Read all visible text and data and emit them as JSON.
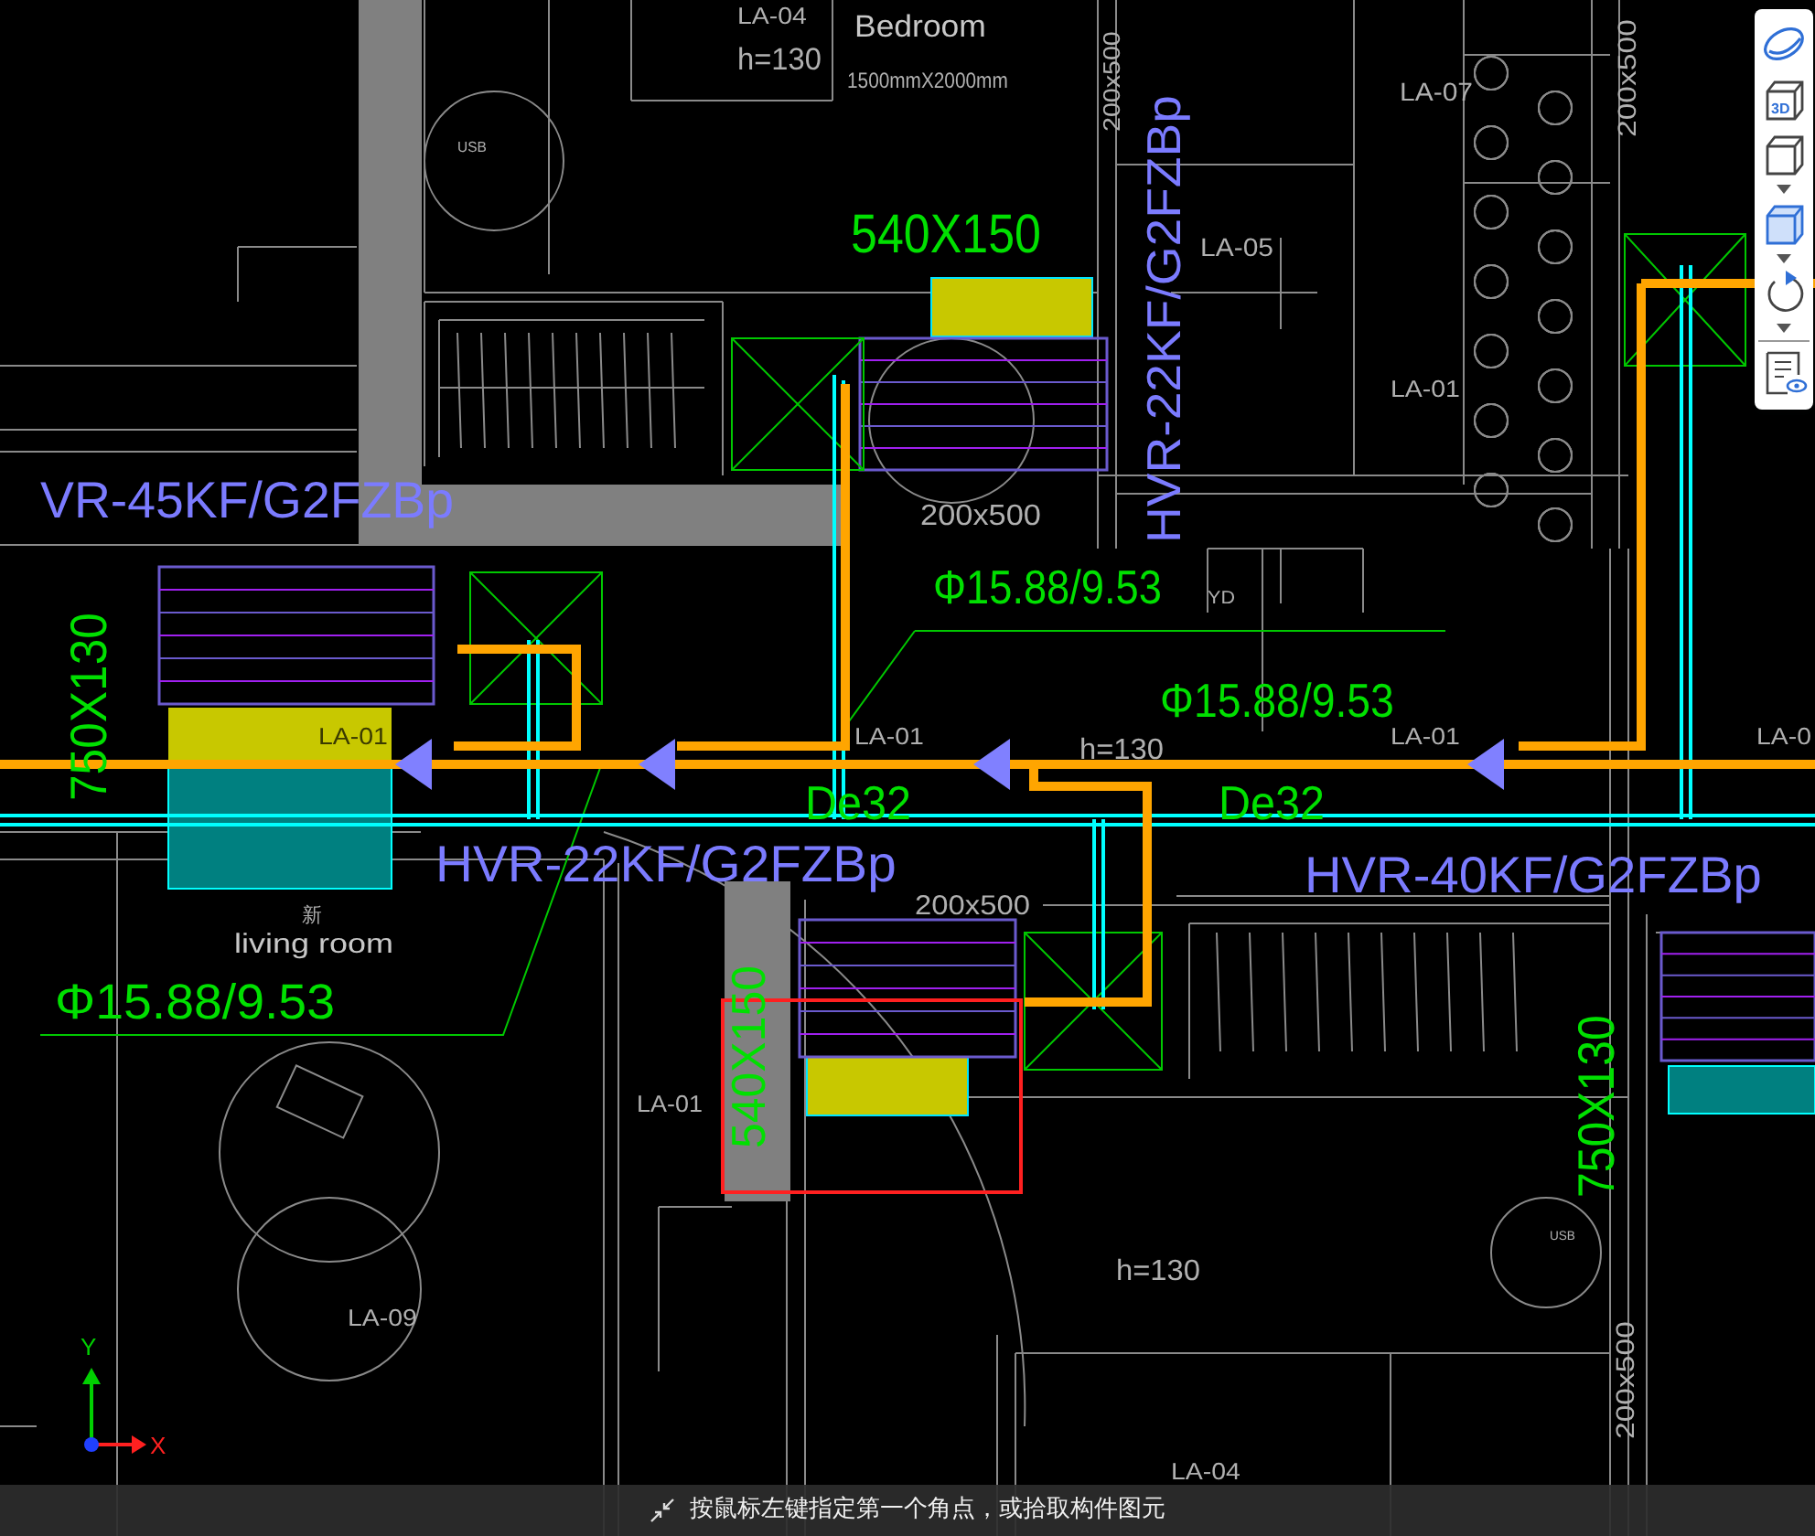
{
  "drawing_labels": [
    {
      "text": "LA-04",
      "kind": "tag"
    },
    {
      "text": "h=130",
      "kind": "elevation"
    },
    {
      "text": "Bedroom",
      "kind": "room"
    },
    {
      "text": "1500mmX2000mm",
      "kind": "note"
    },
    {
      "text": "USB",
      "kind": "note"
    },
    {
      "text": "540X150",
      "kind": "size"
    },
    {
      "text": "200x500",
      "kind": "tag"
    },
    {
      "text": "HVR-22KF/G2FZBp",
      "kind": "model"
    },
    {
      "text": "LA-07",
      "kind": "tag"
    },
    {
      "text": "LA-05",
      "kind": "tag"
    },
    {
      "text": "LA-01",
      "kind": "tag"
    },
    {
      "text": "200x500",
      "kind": "tag"
    },
    {
      "text": "VR-45KF/G2FZBp",
      "kind": "model"
    },
    {
      "text": "200x500",
      "kind": "tag"
    },
    {
      "text": "Φ15.88/9.53",
      "kind": "pipe"
    },
    {
      "text": "YD",
      "kind": "note"
    },
    {
      "text": "750X130",
      "kind": "size"
    },
    {
      "text": "LA-01",
      "kind": "tag"
    },
    {
      "text": "LA-01",
      "kind": "tag"
    },
    {
      "text": "Φ15.88/9.53",
      "kind": "pipe"
    },
    {
      "text": "LA-01",
      "kind": "tag"
    },
    {
      "text": "LA-0",
      "kind": "tag"
    },
    {
      "text": "h=130",
      "kind": "elevation"
    },
    {
      "text": "De32",
      "kind": "pipe"
    },
    {
      "text": "De32",
      "kind": "pipe"
    },
    {
      "text": "HVR-22KF/G2FZBp",
      "kind": "model"
    },
    {
      "text": "HVR-40KF/G2FZBp",
      "kind": "model"
    },
    {
      "text": "200x500",
      "kind": "tag"
    },
    {
      "text": "新",
      "kind": "note"
    },
    {
      "text": "living room",
      "kind": "room"
    },
    {
      "text": "Φ15.88/9.53",
      "kind": "pipe"
    },
    {
      "text": "540X150",
      "kind": "size"
    },
    {
      "text": "LA-01",
      "kind": "tag"
    },
    {
      "text": "750X130",
      "kind": "size"
    },
    {
      "text": "USB",
      "kind": "note"
    },
    {
      "text": "h=130",
      "kind": "elevation"
    },
    {
      "text": "LA-09",
      "kind": "tag"
    },
    {
      "text": "200x500",
      "kind": "tag"
    },
    {
      "text": "LA-04",
      "kind": "tag"
    }
  ],
  "toolbar": [
    {
      "kind": "orbit",
      "has_menu": false
    },
    {
      "kind": "cube-3d",
      "label": "3D",
      "has_menu": false
    },
    {
      "kind": "cube",
      "has_menu": true
    },
    {
      "kind": "cube-filled",
      "has_menu": true
    },
    {
      "kind": "rotate",
      "has_menu": true
    },
    {
      "kind": "properties",
      "has_menu": false
    }
  ],
  "axis": {
    "y_label": "Y",
    "x_label": "X"
  },
  "status_bar": {
    "prompt": "按鼠标左键指定第一个角点，或拾取构件图元"
  }
}
